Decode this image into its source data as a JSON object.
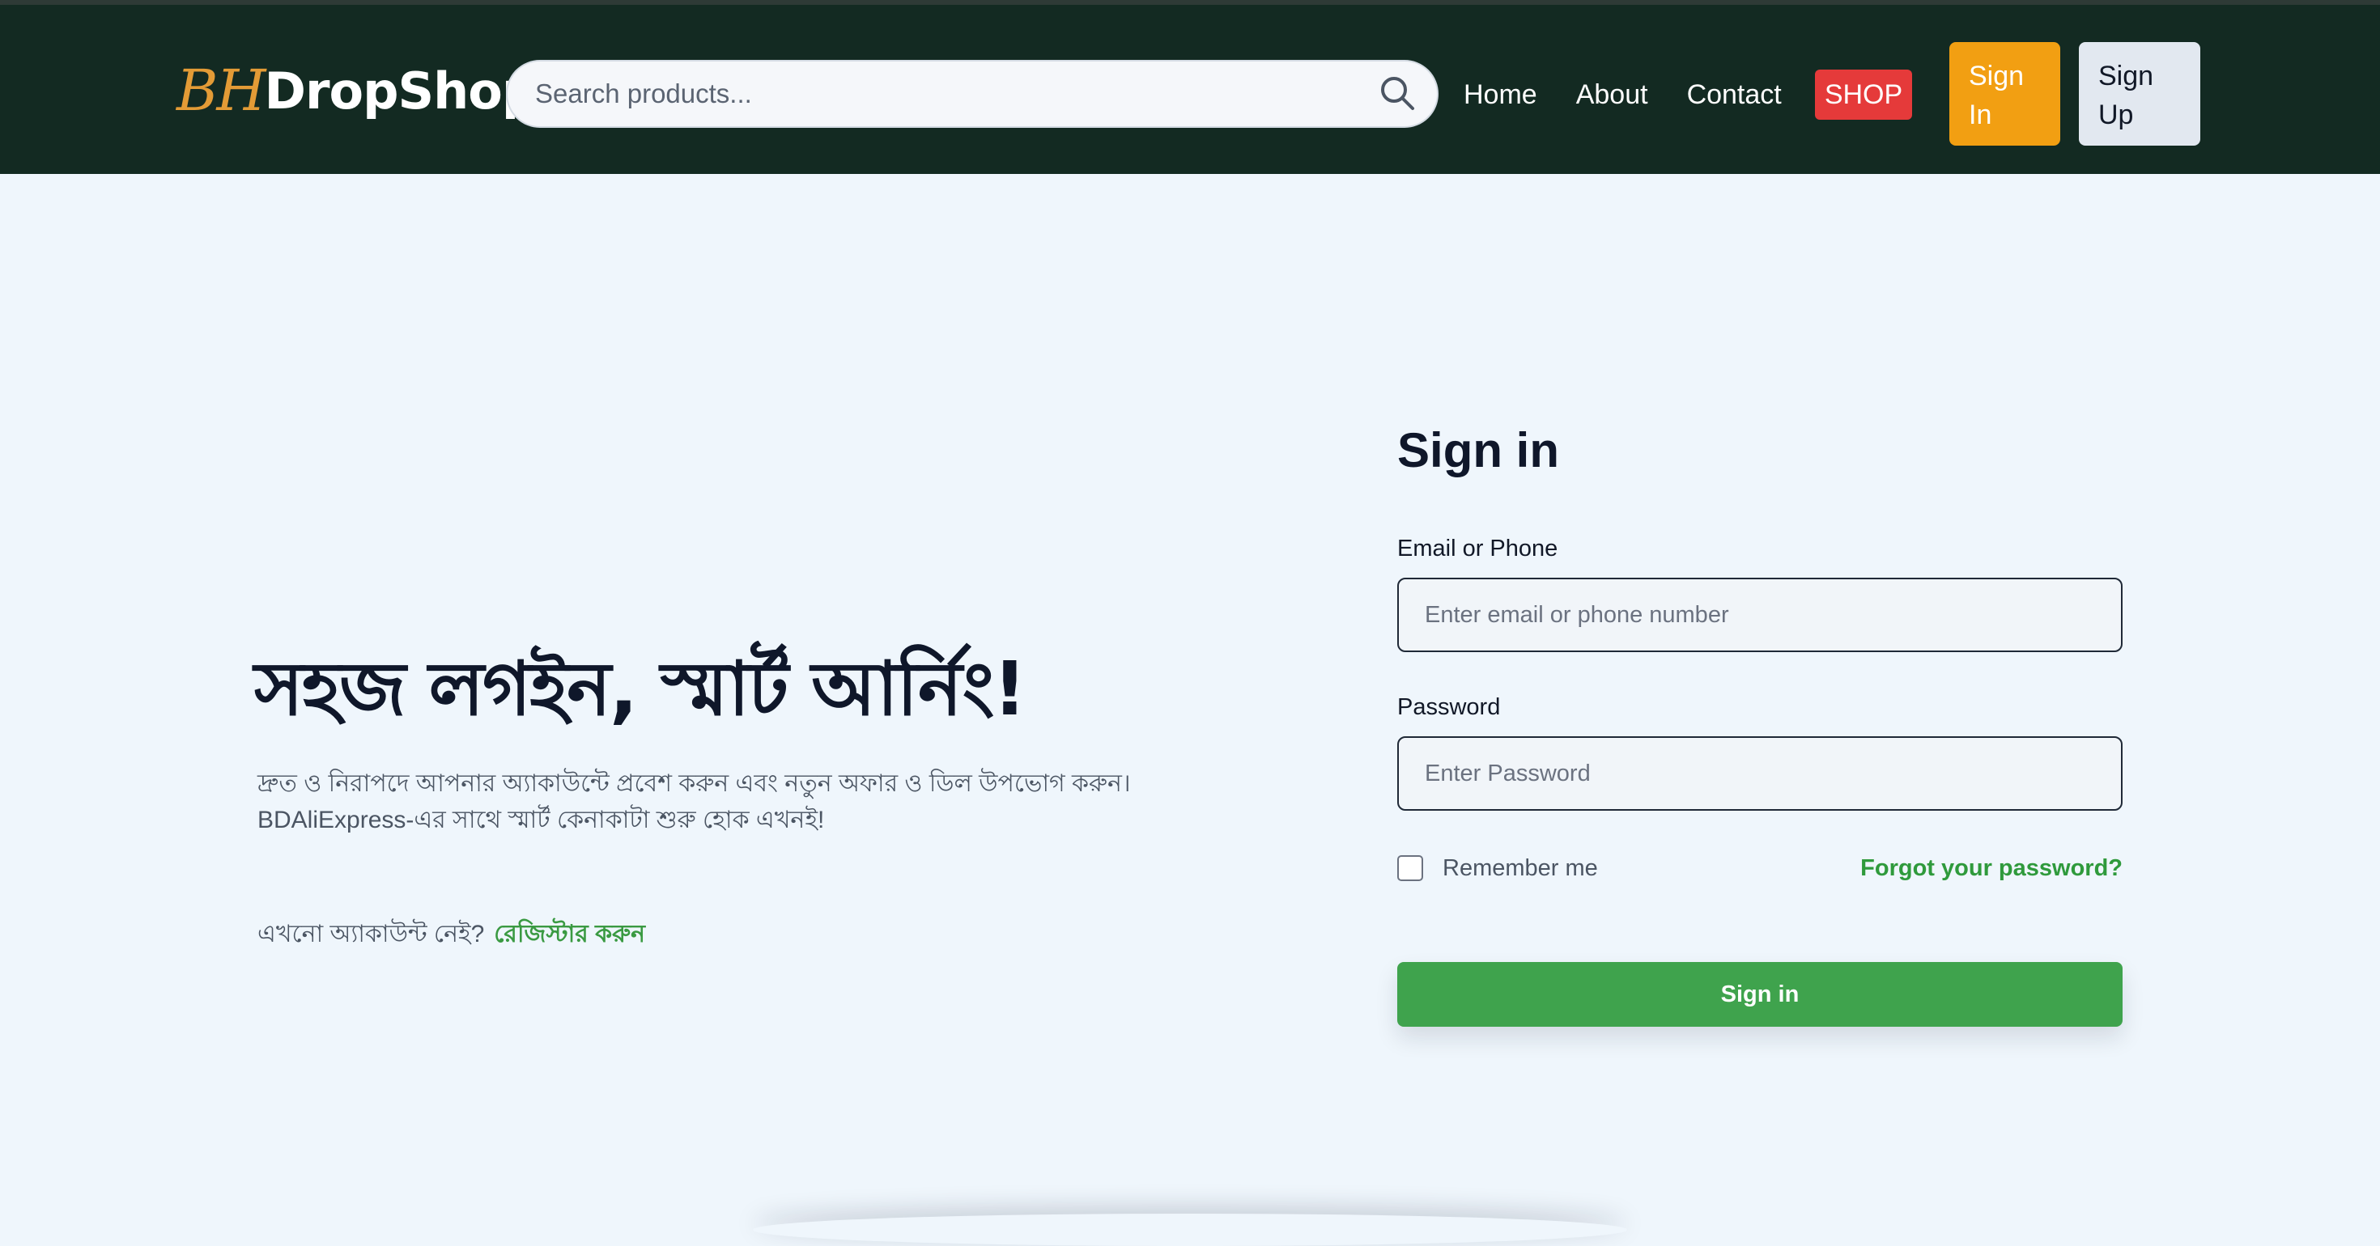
{
  "header": {
    "logo_bh": "BH",
    "logo_dropshop": "DropShop",
    "search_placeholder": "Search products...",
    "nav": [
      "Home",
      "About",
      "Contact"
    ],
    "shop_label": "SHOP",
    "signin_line1": "Sign",
    "signin_line2": "In",
    "signup_line1": "Sign",
    "signup_line2": "Up",
    "colors": {
      "navbar_bg": "#132a22",
      "shop_bg": "#e53a3a",
      "signin_bg": "#f29f12",
      "signup_bg": "#e2e8f0"
    }
  },
  "hero": {
    "title": "সহজ লগইন, স্মার্ট আর্নিং!",
    "line1": "দ্রুত ও নিরাপদে আপনার অ্যাকাউন্টে প্রবেশ করুন এবং নতুন অফার ও ডিল উপভোগ করুন।",
    "line2": "BDAliExpress-এর সাথে স্মার্ট কেনাকাটা শুরু হোক এখনই!",
    "no_account": "এখনো অ্যাকাউন্ট নেই?",
    "register_link": "রেজিস্টার করুন"
  },
  "form": {
    "title": "Sign in",
    "email_label": "Email or Phone",
    "email_placeholder": "Enter email or phone number",
    "password_label": "Password",
    "password_placeholder": "Enter Password",
    "remember_label": "Remember me",
    "forgot_link": "Forgot your password?",
    "submit_label": "Sign in",
    "colors": {
      "submit_bg": "#3fa34d",
      "link": "#2f9a3c"
    }
  },
  "icons": {
    "search": "search-icon"
  }
}
